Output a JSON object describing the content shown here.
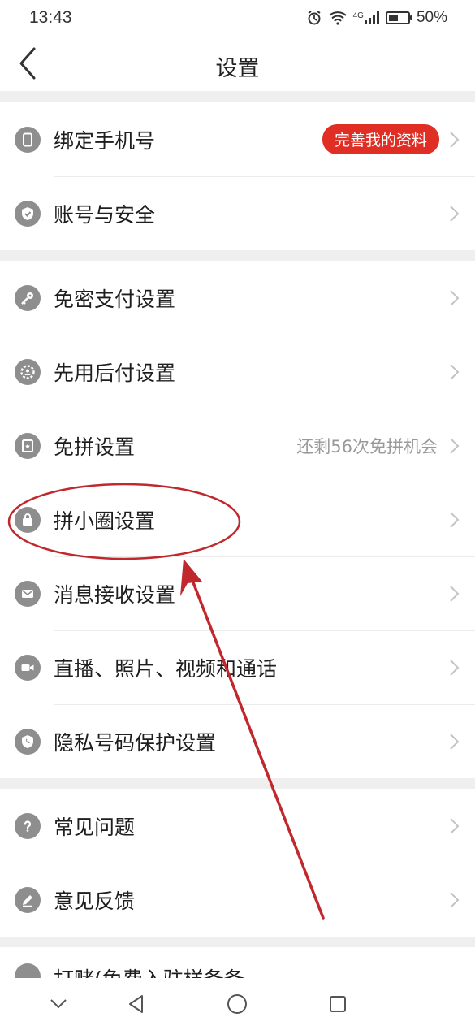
{
  "status_bar": {
    "time": "13:43",
    "network": "4G",
    "battery": "50%",
    "battery_level": 0.5
  },
  "nav": {
    "title": "设置",
    "back_icon": "chevron-left-icon"
  },
  "groups": [
    {
      "items": [
        {
          "label": "绑定手机号",
          "icon": "phone-icon",
          "badge": "完善我的资料"
        },
        {
          "label": "账号与安全",
          "icon": "shield-icon"
        }
      ]
    },
    {
      "items": [
        {
          "label": "免密支付设置",
          "icon": "key-icon"
        },
        {
          "label": "先用后付设置",
          "icon": "gear-person-icon"
        },
        {
          "label": "免拼设置",
          "icon": "coupon-icon",
          "value": "还剩56次免拼机会"
        },
        {
          "label": "拼小圈设置",
          "icon": "bag-icon"
        },
        {
          "label": "消息接收设置",
          "icon": "envelope-icon"
        },
        {
          "label": "直播、照片、视频和通话",
          "icon": "video-camera-icon"
        },
        {
          "label": "隐私号码保护设置",
          "icon": "phone-shield-icon"
        }
      ]
    },
    {
      "items": [
        {
          "label": "常见问题",
          "icon": "question-icon"
        },
        {
          "label": "意见反馈",
          "icon": "pencil-icon"
        }
      ]
    }
  ],
  "partial_item": {
    "label": "打赌(免费入驻样备备",
    "icon": "partial-icon"
  },
  "system_nav": {
    "back": "triangle-back-icon",
    "home": "circle-home-icon",
    "recents": "square-recents-icon",
    "collapse": "chevron-down-icon"
  },
  "colors": {
    "accent": "#e02e24",
    "icon_gray": "#8e8e8e",
    "separator": "#efefef",
    "annotation": "#c0282d"
  }
}
